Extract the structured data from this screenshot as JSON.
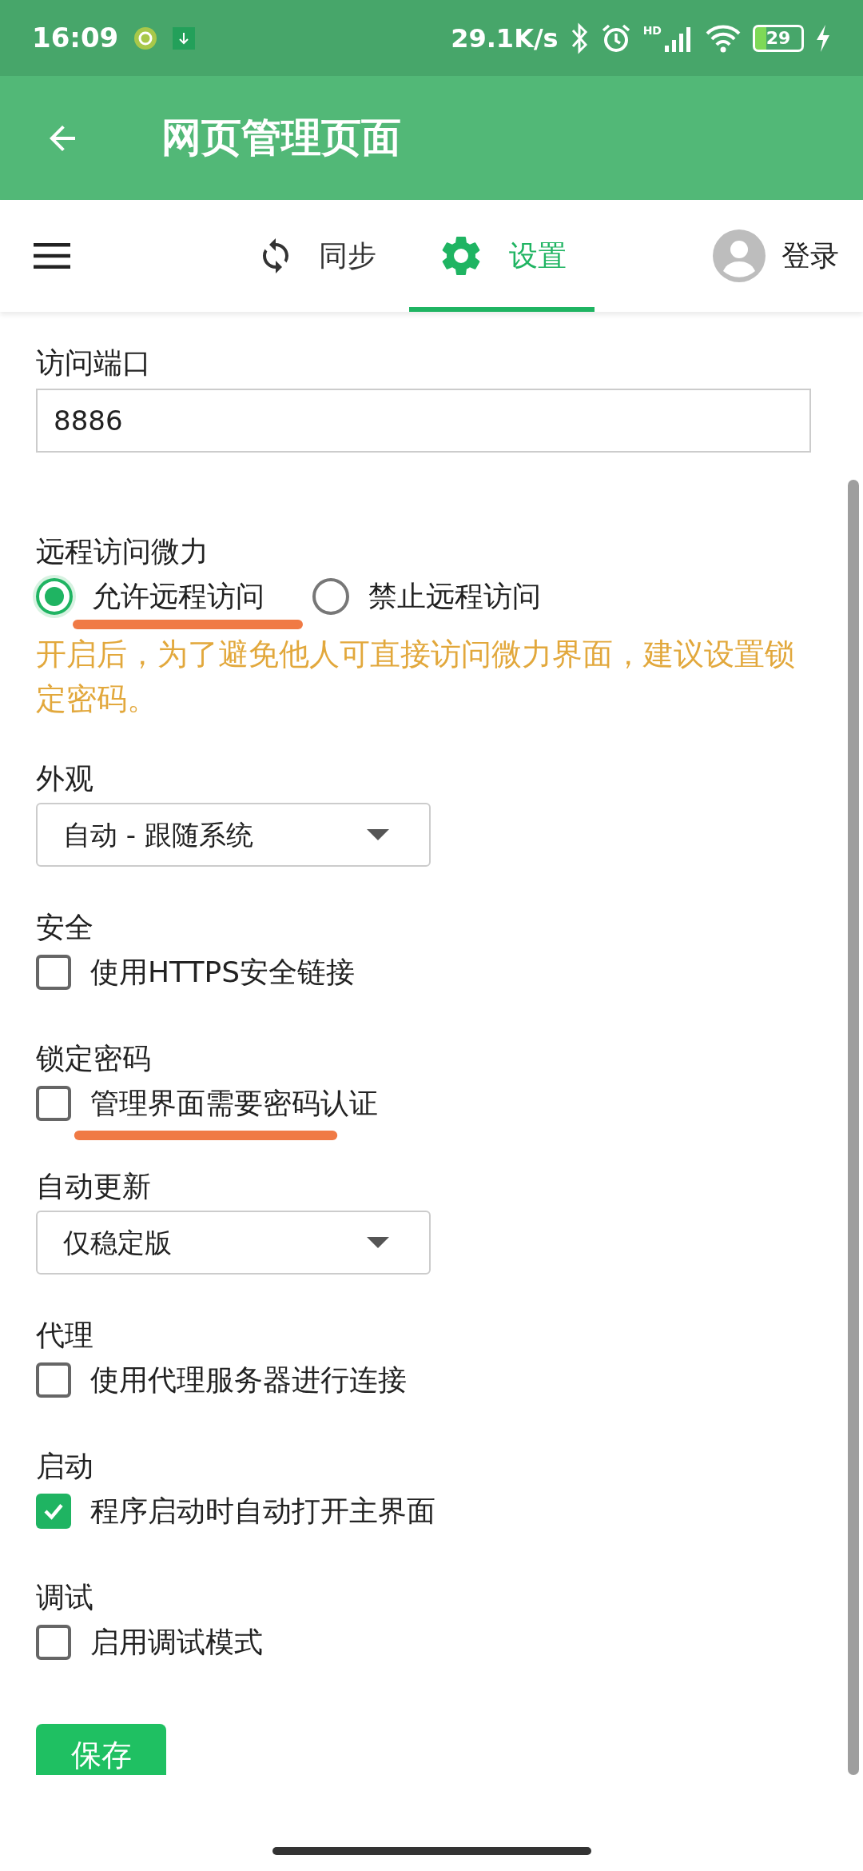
{
  "status_bar": {
    "time": "16:09",
    "speed": "29.1K/s",
    "network": "HD",
    "battery": "29"
  },
  "app_bar": {
    "title": "网页管理页面"
  },
  "tabs": [
    {
      "label": "同步",
      "selected": false
    },
    {
      "label": "设置",
      "selected": true
    }
  ],
  "login": {
    "label": "登录"
  },
  "settings": [
    {
      "kind": "input",
      "label": "访问端口",
      "value": "8886"
    },
    {
      "kind": "radio",
      "label": "远程访问微力",
      "options": [
        {
          "label": "允许远程访问",
          "selected": true,
          "annotated": true
        },
        {
          "label": "禁止远程访问",
          "selected": false,
          "annotated": false
        }
      ],
      "note": "开启后，为了避免他人可直接访问微力界面，建议设置锁定密码。"
    },
    {
      "kind": "select",
      "label": "外观",
      "value": "自动 - 跟随系统"
    },
    {
      "kind": "checkbox",
      "label": "安全",
      "option": {
        "label": "使用HTTPS安全链接",
        "checked": false,
        "annotated": false
      }
    },
    {
      "kind": "checkbox",
      "label": "锁定密码",
      "option": {
        "label": "管理界面需要密码认证",
        "checked": false,
        "annotated": true
      }
    },
    {
      "kind": "select",
      "label": "自动更新",
      "value": "仅稳定版"
    },
    {
      "kind": "checkbox",
      "label": "代理",
      "option": {
        "label": "使用代理服务器进行连接",
        "checked": false,
        "annotated": false
      }
    },
    {
      "kind": "checkbox",
      "label": "启动",
      "option": {
        "label": "程序启动时自动打开主界面",
        "checked": true,
        "annotated": false
      }
    },
    {
      "kind": "checkbox",
      "label": "调试",
      "option": {
        "label": "启用调试模式",
        "checked": false,
        "annotated": false
      }
    }
  ],
  "save_button": {
    "label": "保存"
  }
}
